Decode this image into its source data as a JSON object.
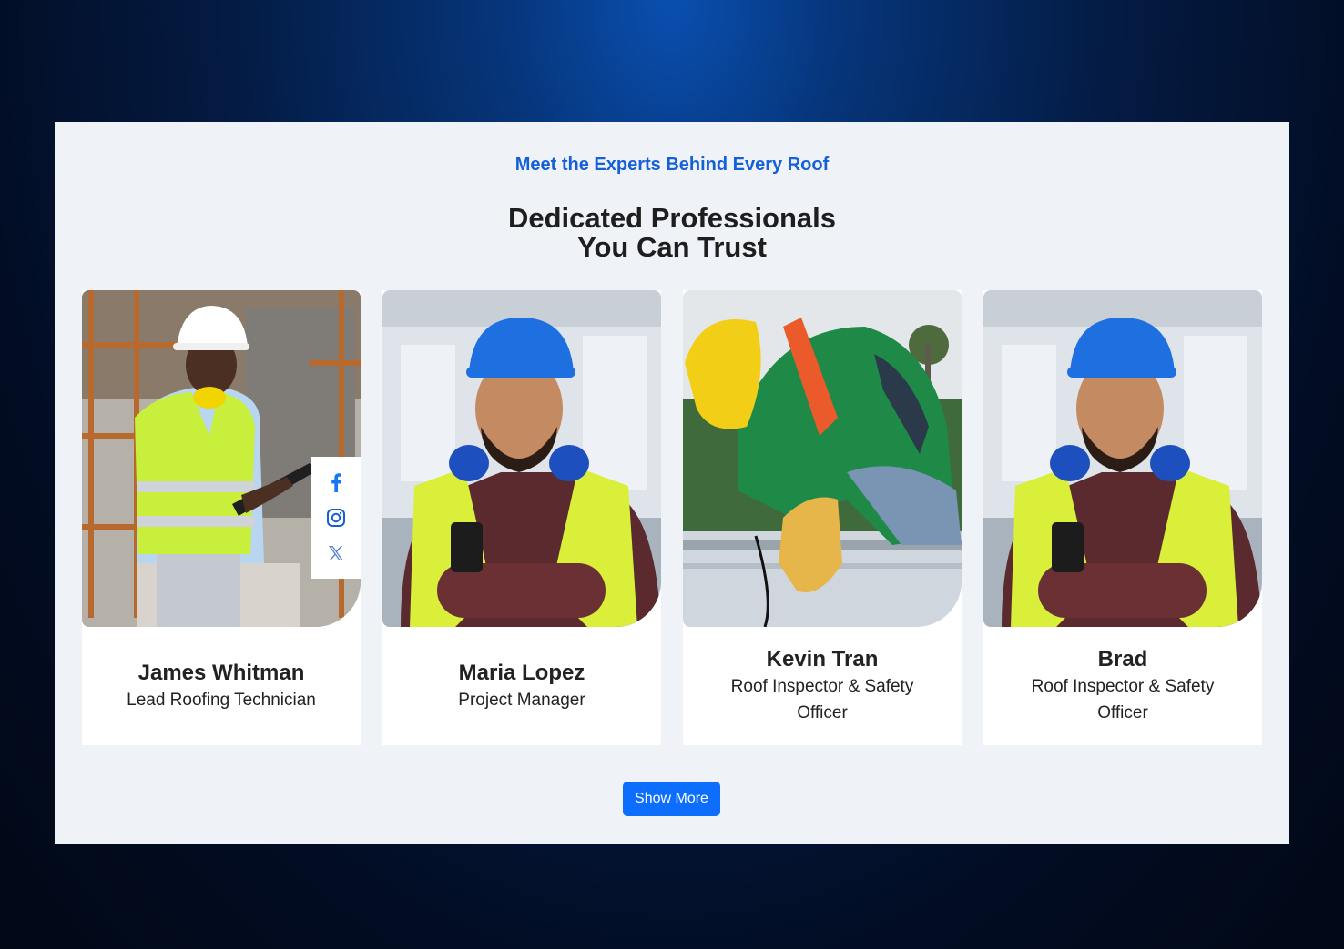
{
  "section": {
    "eyebrow": "Meet the Experts Behind Every Roof",
    "heading_line1": "Dedicated Professionals",
    "heading_line2": "You Can Trust"
  },
  "team": [
    {
      "name": "James Whitman",
      "role": "Lead Roofing Technician",
      "photo": "worker-white-hardhat-clipboard-photo"
    },
    {
      "name": "Maria Lopez",
      "role": "Project Manager",
      "photo": "worker-blue-hardhat-arms-crossed-photo"
    },
    {
      "name": "Kevin Tran",
      "role": "Roof Inspector & Safety Officer",
      "photo": "worker-yellow-hardhat-working-photo"
    },
    {
      "name": "Brad",
      "role": "Roof Inspector & Safety Officer",
      "photo": "worker-blue-hardhat-arms-crossed-photo"
    }
  ],
  "social_icons": [
    "facebook-icon",
    "instagram-icon",
    "x-twitter-icon"
  ],
  "button": {
    "label": "Show More"
  },
  "colors": {
    "accent": "#1560d8",
    "button": "#0d6efd",
    "panel": "#eff3f8",
    "text": "#1e1e1e"
  }
}
